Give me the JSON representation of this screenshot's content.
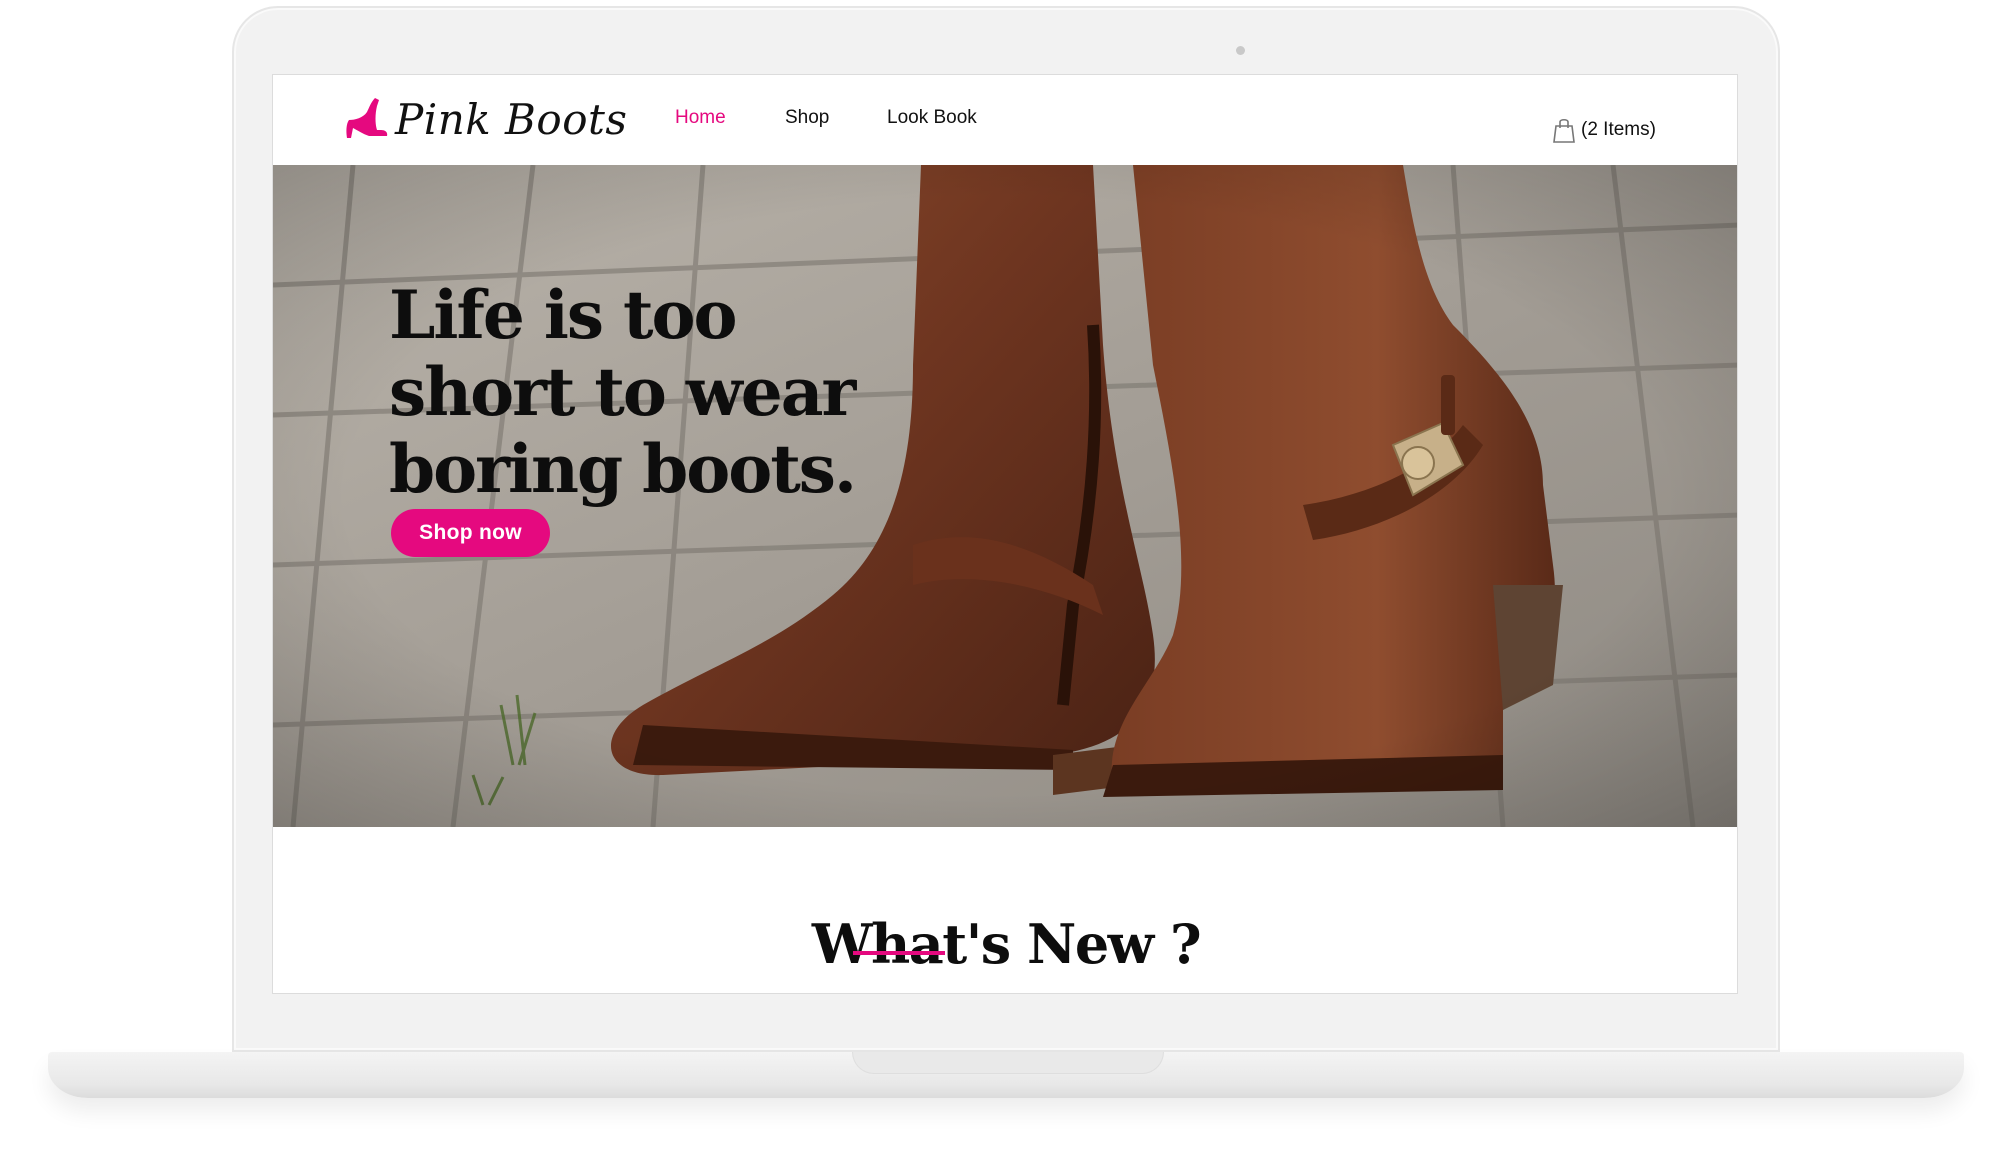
{
  "site": {
    "brand": "Pink Boots",
    "accent_color": "#e5097f"
  },
  "nav": {
    "items": [
      {
        "label": "Home",
        "active": true
      },
      {
        "label": "Shop",
        "active": false
      },
      {
        "label": "Look Book",
        "active": false
      }
    ]
  },
  "cart": {
    "label": "(2 Items)",
    "icon": "shopping-bag-icon"
  },
  "hero": {
    "headline_lines": [
      "Life is too",
      "short to wear",
      "boring boots."
    ],
    "cta_label": "Shop now"
  },
  "section": {
    "title": "What's New ?"
  }
}
